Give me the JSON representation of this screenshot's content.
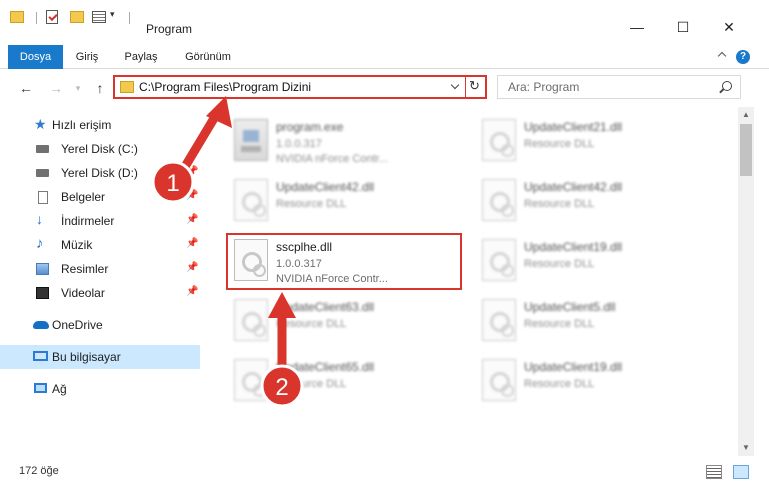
{
  "window": {
    "title": "Program",
    "minimize": "—",
    "maximize": "☐",
    "close": "✕"
  },
  "ribbon": {
    "tabs": [
      "Dosya",
      "Giriş",
      "Paylaş",
      "Görünüm"
    ],
    "help": "?"
  },
  "nav": {
    "back": "←",
    "forward": "→",
    "up": "↑",
    "address": "C:\\Program Files\\Program Dizini",
    "refresh": "↻",
    "search_placeholder": "Ara: Program"
  },
  "sidebar": {
    "items": [
      {
        "label": "Hızlı erişim",
        "icon": "star-icon",
        "pinned": false
      },
      {
        "label": "Yerel Disk (C:)",
        "icon": "disk-icon",
        "pinned": false
      },
      {
        "label": "Yerel Disk (D:)",
        "icon": "disk-icon",
        "pinned": true
      },
      {
        "label": "Belgeler",
        "icon": "documents-icon",
        "pinned": true
      },
      {
        "label": "İndirmeler",
        "icon": "downloads-icon",
        "pinned": true
      },
      {
        "label": "Müzik",
        "icon": "music-icon",
        "pinned": true
      },
      {
        "label": "Resimler",
        "icon": "pictures-icon",
        "pinned": true
      },
      {
        "label": "Videolar",
        "icon": "videos-icon",
        "pinned": true
      },
      {
        "label": "OneDrive",
        "icon": "onedrive-icon",
        "pinned": false
      },
      {
        "label": "Bu bilgisayar",
        "icon": "this-pc-icon",
        "pinned": false,
        "selected": true
      },
      {
        "label": "Ağ",
        "icon": "network-icon",
        "pinned": false
      }
    ]
  },
  "files": [
    {
      "name": "program.exe",
      "line1": "1.0.0.317",
      "line2": "NVIDIA nForce Contr...",
      "type": "exe"
    },
    {
      "name": "UpdateClient21.dll",
      "line1": "Resource DLL",
      "type": "dll"
    },
    {
      "name": "UpdateClient42.dll",
      "line1": "Resource DLL",
      "type": "dll"
    },
    {
      "name": "UpdateClient42.dll",
      "line1": "Resource DLL",
      "type": "dll"
    },
    {
      "name": "sscplhe.dll",
      "line1": "1.0.0.317",
      "line2": "NVIDIA nForce Contr...",
      "type": "dll",
      "highlighted": true
    },
    {
      "name": "UpdateClient19.dll",
      "line1": "Resource DLL",
      "type": "dll"
    },
    {
      "name": "UpdateClient63.dll",
      "line1": "Resource DLL",
      "type": "dll"
    },
    {
      "name": "UpdateClient5.dll",
      "line1": "Resource DLL",
      "type": "dll"
    },
    {
      "name": "UpdateClient65.dll",
      "line1": "Resource DLL",
      "type": "dll"
    },
    {
      "name": "UpdateClient19.dll",
      "line1": "Resource DLL",
      "type": "dll"
    }
  ],
  "status": {
    "count": "172 öğe"
  },
  "annotations": {
    "step1": "1",
    "step2": "2",
    "color": "#d9352c"
  }
}
